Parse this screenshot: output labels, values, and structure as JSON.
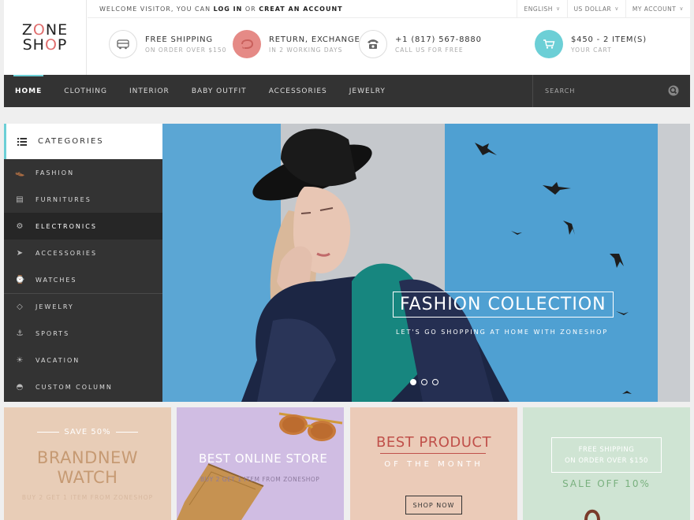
{
  "logo": {
    "line1_a": "Z",
    "line1_o": "O",
    "line1_b": "NE",
    "line2_a": "SH",
    "line2_o": "O",
    "line2_b": "P"
  },
  "topbar": {
    "welcome_prefix": "WELCOME VISITOR, YOU CAN ",
    "login": "LOG IN",
    "welcome_or": " OR ",
    "create_account": "CREAT AN ACCOUNT",
    "language": "ENGLISH",
    "currency": "US DOLLAR",
    "account": "MY ACCOUNT"
  },
  "info": [
    {
      "title": "FREE SHIPPING",
      "sub": "ON ORDER OVER $150",
      "icon": "truck-icon",
      "color": "#ffffff"
    },
    {
      "title": "RETURN, EXCHANGE",
      "sub": "IN 2 WORKING DAYS",
      "icon": "return-icon",
      "color": "#e58a86"
    },
    {
      "title": "+1 (817) 567-8880",
      "sub": "CALL US FOR FREE",
      "icon": "phone-icon",
      "color": "#ffffff"
    },
    {
      "title": "$450 - 2 ITEM(S)",
      "sub": "YOUR CART",
      "icon": "cart-icon",
      "color": "#6ccfd6"
    }
  ],
  "nav": {
    "items": [
      "HOME",
      "CLOTHING",
      "INTERIOR",
      "BABY OUTFIT",
      "ACCESSORIES",
      "JEWELRY"
    ],
    "search_placeholder": "SEARCH"
  },
  "categories": {
    "title": "CATEGORIES",
    "items": [
      {
        "label": "FASHION",
        "icon": "shoe-icon",
        "glyph": "👞"
      },
      {
        "label": "FURNITURES",
        "icon": "cabinet-icon",
        "glyph": "▤"
      },
      {
        "label": "ELECTRONICS",
        "icon": "gear-icon",
        "glyph": "⚙"
      },
      {
        "label": "ACCESSORIES",
        "icon": "paper-plane-icon",
        "glyph": "➤"
      },
      {
        "label": "WATCHES",
        "icon": "watch-icon",
        "glyph": "⌚"
      },
      {
        "label": "JEWELRY",
        "icon": "diamond-icon",
        "glyph": "◇"
      },
      {
        "label": "SPORTS",
        "icon": "anchor-icon",
        "glyph": "⚓"
      },
      {
        "label": "VACATION",
        "icon": "sun-icon",
        "glyph": "☀"
      },
      {
        "label": "CUSTOM COLUMN",
        "icon": "helmet-icon",
        "glyph": "◓"
      }
    ]
  },
  "hero": {
    "title": "FASHION COLLECTION",
    "subtitle": "LET'S GO SHOPPING AT HOME WITH ZONESHOP",
    "slide_count": 3,
    "active_slide": 1
  },
  "banners": {
    "b1": {
      "kicker": "SAVE 50%",
      "title_1": "BRANDNEW",
      "title_2": "WATCH",
      "sub": "BUY 2 GET 1 ITEM FROM ZONESHOP"
    },
    "b2": {
      "title": "BEST ONLINE STORE",
      "sub": "BUY 2 GET 1 ITEM FROM ZONESHOP"
    },
    "b3": {
      "title": "BEST PRODUCT",
      "sub": "OF THE MONTH",
      "button": "SHOP NOW"
    },
    "b4": {
      "line1": "FREE SHIPPING",
      "line2": "ON ORDER OVER $150",
      "sale": "SALE OFF 10%"
    }
  }
}
